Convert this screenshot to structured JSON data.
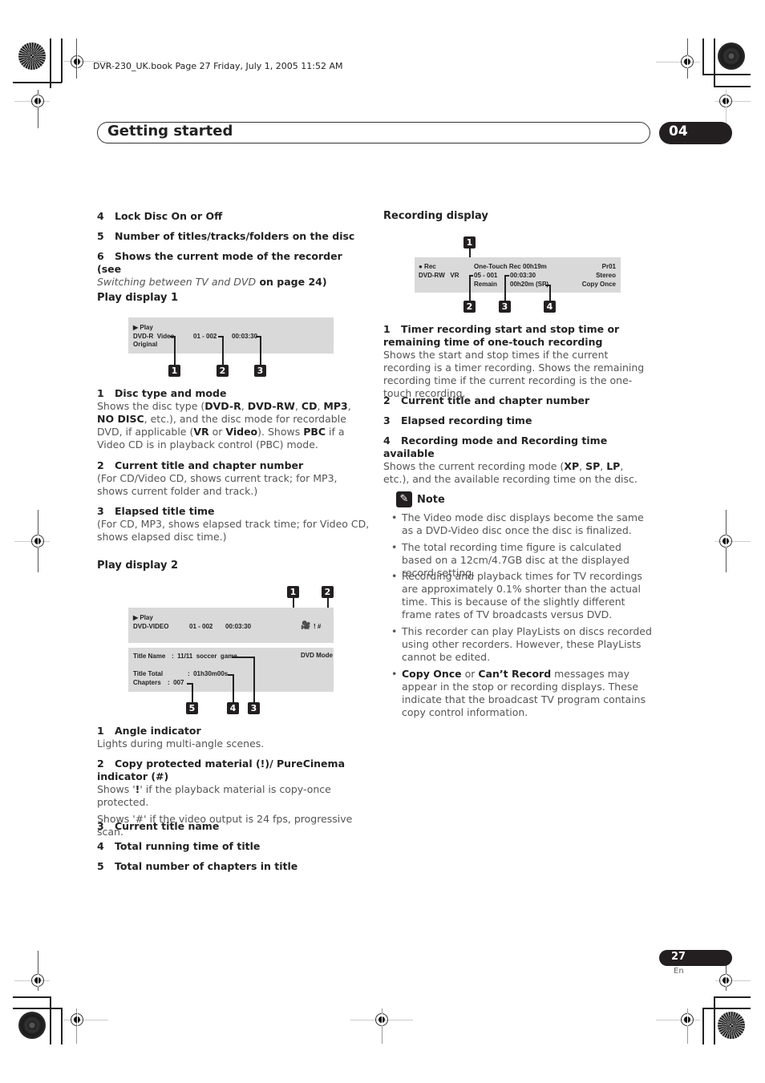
{
  "print_header": "DVR-230_UK.book  Page 27  Friday, July 1, 2005  11:52 AM",
  "chapter": {
    "title": "Getting started",
    "number": "04"
  },
  "left_top_items": [
    {
      "num": "4",
      "label": "Lock Disc On or Off"
    },
    {
      "num": "5",
      "label": "Number of titles/tracks/folders on the disc"
    },
    {
      "num": "6",
      "label": "Shows the current mode of the recorder (see",
      "ref_italic": "Switching between TV and DVD",
      "ref_tail": " on page 24)"
    }
  ],
  "play_display_1": {
    "heading": "Play display 1",
    "lcd": {
      "status": "▶ Play",
      "disc": "DVD-R  Video",
      "mode": "Original",
      "chapter": "01 - 002",
      "time": "00:03:30"
    },
    "callouts": [
      "1",
      "2",
      "3"
    ],
    "items": [
      {
        "num": "1",
        "label": "Disc type and mode",
        "desc_parts": [
          "Shows the disc type (",
          "DVD-R",
          ", ",
          "DVD-RW",
          ", ",
          "CD",
          ", ",
          "MP3",
          ", ",
          "NO DISC",
          ", etc.), and the disc mode for recordable DVD, if applicable (",
          "VR",
          " or ",
          "Video",
          ").  Shows ",
          "PBC",
          " if a Video CD is in playback control (PBC) mode."
        ]
      },
      {
        "num": "2",
        "label": "Current title and chapter number",
        "desc": "(For CD/Video CD, shows current track; for MP3, shows current folder and track.)"
      },
      {
        "num": "3",
        "label": "Elapsed title time",
        "desc": "(For CD, MP3, shows elapsed track time; for Video CD, shows elapsed disc time.)"
      }
    ]
  },
  "play_display_2": {
    "heading": "Play display 2",
    "lcd_top": {
      "status": "▶ Play",
      "disc": "DVD-VIDEO",
      "chapter": "01 - 002",
      "time": "00:03:30",
      "indicators": "! #"
    },
    "lcd_bottom": {
      "title_name_label": "Title Name",
      "title_name_value": ":  11/11  soccer  game",
      "mode": "DVD Mode",
      "title_total_label": "Title Total",
      "title_total_value": ":  01h30m00s",
      "chapters_label": "Chapters",
      "chapters_value": ":  007"
    },
    "callouts": [
      "1",
      "2",
      "5",
      "4",
      "3"
    ],
    "items": [
      {
        "num": "1",
        "label": "Angle indicator",
        "desc": "Lights during multi-angle scenes."
      },
      {
        "num": "2",
        "label": "Copy protected material (!)/ PureCinema indicator (#)",
        "desc1_pre": "Shows '",
        "desc1_bold": "!",
        "desc1_post": "' if the playback material is copy-once protected.",
        "desc2": "Shows '#' if the video output is 24 fps, progressive scan."
      },
      {
        "num": "3",
        "label": "Current title name"
      },
      {
        "num": "4",
        "label": "Total running time of title"
      },
      {
        "num": "5",
        "label": "Total number of chapters in title"
      }
    ]
  },
  "recording_display": {
    "heading": "Recording display",
    "lcd": {
      "status": "● Rec",
      "disc": "DVD-RW   VR",
      "rec_type": "One-Touch Rec",
      "rec_remaining": "00h19m",
      "chapter": "05 - 001",
      "remain_label": "Remain",
      "elapsed": "00:03:30",
      "available": "00h20m (SP)",
      "channel": "Pr01",
      "audio": "Stereo",
      "copy": "Copy Once"
    },
    "callouts": [
      "1",
      "2",
      "3",
      "4"
    ],
    "items": [
      {
        "num": "1",
        "label": "Timer recording start and stop time or remaining time of one-touch recording",
        "desc": "Shows the start and stop times if the current recording is a timer recording. Shows the remaining recording time if the current recording is the one-touch recording."
      },
      {
        "num": "2",
        "label": "Current title and chapter number"
      },
      {
        "num": "3",
        "label": "Elapsed recording time"
      },
      {
        "num": "4",
        "label": "Recording mode and Recording time available",
        "desc_parts": [
          "Shows the current recording mode (",
          "XP",
          ", ",
          "SP",
          ", ",
          "LP",
          ", etc.), and the available recording time on the disc."
        ]
      }
    ]
  },
  "note": {
    "heading": "Note",
    "icon": "pencil-icon",
    "bullets": [
      "The Video mode disc displays become the same as a DVD-Video disc once the disc is finalized.",
      "The total recording time figure is calculated based on a 12cm/4.7GB disc at the displayed record setting.",
      "Recording and playback times for TV recordings are approximately 0.1% shorter than the actual time. This is because of the slightly different frame rates of TV broadcasts versus DVD.",
      "This recorder can play PlayLists on discs recorded using other recorders. However, these PlayLists cannot be edited."
    ],
    "last_bullet": {
      "b1": "Copy Once",
      "mid": " or ",
      "b2": "Can’t Record",
      "tail": " messages may appear in the stop or recording displays. These indicate that the broadcast TV program contains copy control information."
    }
  },
  "footer": {
    "page": "27",
    "lang": "En"
  }
}
